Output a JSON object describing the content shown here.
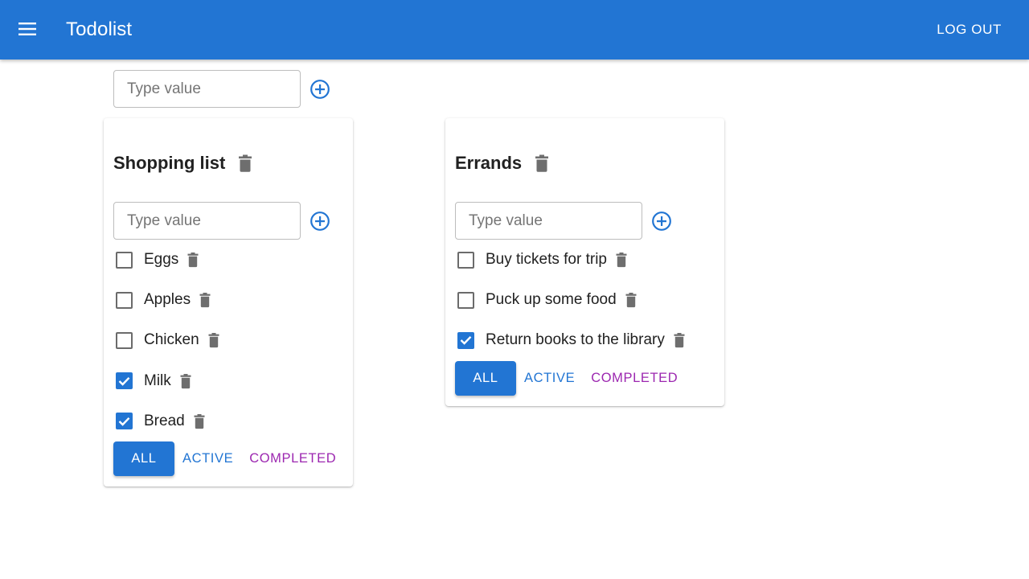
{
  "app": {
    "title": "Todolist",
    "logout_label": "LOG OUT",
    "brand_color": "#2275d3"
  },
  "new_list": {
    "placeholder": "Type value"
  },
  "lists": [
    {
      "title": "Shopping list",
      "input_placeholder": "Type value",
      "tasks": [
        {
          "label": "Eggs",
          "done": false
        },
        {
          "label": "Apples",
          "done": false
        },
        {
          "label": "Chicken",
          "done": false
        },
        {
          "label": "Milk",
          "done": true
        },
        {
          "label": "Bread",
          "done": true
        }
      ],
      "filters": {
        "all": "ALL",
        "active": "ACTIVE",
        "completed": "COMPLETED",
        "selected": "all"
      }
    },
    {
      "title": "Errands",
      "input_placeholder": "Type value",
      "tasks": [
        {
          "label": "Buy tickets for trip",
          "done": false
        },
        {
          "label": "Puck up some food",
          "done": false
        },
        {
          "label": "Return books to the library",
          "done": true
        }
      ],
      "filters": {
        "all": "ALL",
        "active": "ACTIVE",
        "completed": "COMPLETED",
        "selected": "all"
      }
    }
  ],
  "icons": {
    "menu": "menu-icon",
    "add": "add-circle-outline-icon",
    "delete": "trash-icon",
    "check": "check-icon"
  },
  "colors": {
    "active_filter": "#2275d3",
    "completed_filter": "#9c27b0",
    "icon_gray": "#6e6e6e"
  }
}
